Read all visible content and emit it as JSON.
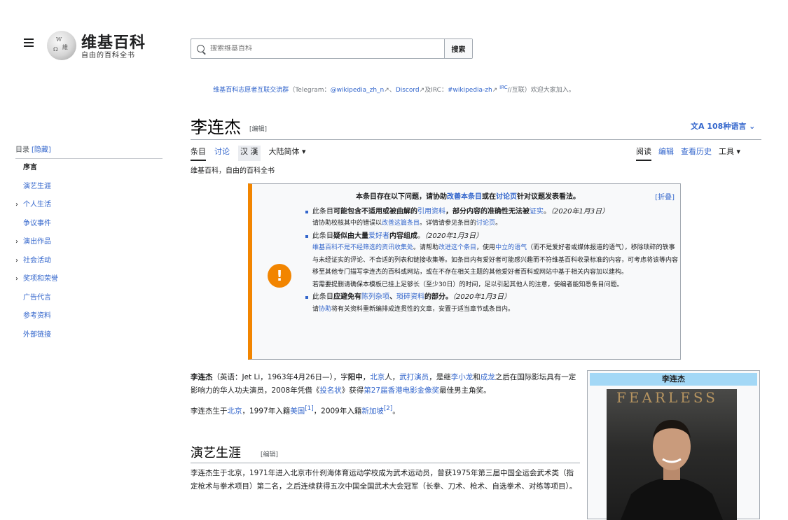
{
  "header": {
    "wordmark": "维基百科",
    "tagline": "自由的百科全书",
    "search_placeholder": "搜索维基百科",
    "search_button": "搜索",
    "globe_glyphs": [
      "W",
      "維",
      "Ω"
    ]
  },
  "sitenotice": {
    "part1": "维基百科志愿者互联交流群",
    "part2": "（Telegram：",
    "telegram": "@wikipedia_zh_n",
    "discord": "Discord",
    "part3": "及IRC：",
    "irc": "#wikipedia-zh",
    "irc_sup": "IRC",
    "part4": "//互联）欢迎大家加入。"
  },
  "title": {
    "text": "李连杰",
    "edit": "[编辑]",
    "languages": "108种语言"
  },
  "tabs": {
    "article": "条目",
    "talk": "讨论",
    "variant": "汉 漢",
    "variant_select": "大陆简体 ▾",
    "read": "阅读",
    "edit": "编辑",
    "history": "查看历史",
    "tools": "工具 ▾"
  },
  "from_wiki": "维基百科，自由的百科全书",
  "toc": {
    "heading": "目录",
    "hide": "[隐藏]",
    "items": [
      {
        "label": "序言",
        "chev": ""
      },
      {
        "label": "演艺生涯",
        "chev": ""
      },
      {
        "label": "个人生活",
        "chev": "›"
      },
      {
        "label": "争议事件",
        "chev": ""
      },
      {
        "label": "演出作品",
        "chev": "›"
      },
      {
        "label": "社会活动",
        "chev": "›"
      },
      {
        "label": "奖项和荣誉",
        "chev": "›"
      },
      {
        "label": "广告代言",
        "chev": ""
      },
      {
        "label": "参考资料",
        "chev": ""
      },
      {
        "label": "外部链接",
        "chev": ""
      }
    ]
  },
  "ambox": {
    "title_a": "本条目存在以下问题",
    "title_b": "，请协助",
    "title_link1": "改善本条目",
    "title_c": "或在",
    "title_link2": "讨论页",
    "title_d": "针对议题发表看法。",
    "toggle": "[折叠]",
    "i1_a": "此条目",
    "i1_b": "可能包含不适用或被曲解的",
    "i1_link": "引用资料",
    "i1_c": "，部分内容的准确性无法被",
    "i1_link2": "证实",
    "i1_d": "。",
    "i1_date": "（2020年1月3日）",
    "i1_sub_a": "请协助校核其中的错误以",
    "i1_sub_link": "改善这篇条目",
    "i1_sub_b": "。详情请参见条目的",
    "i1_sub_link2": "讨论页",
    "i1_sub_c": "。",
    "i2_a": "此条目",
    "i2_b": "疑似由大量",
    "i2_link": "爱好者",
    "i2_c": "内容组成",
    "i2_d": "。",
    "i2_date": "（2020年1月3日）",
    "i2_sub_link": "维基百科不是不经筛选的资讯收集处",
    "i2_sub_a": "。请帮助",
    "i2_sub_link2": "改进这个条目",
    "i2_sub_b": "，使用",
    "i2_sub_link3": "中立的语气",
    "i2_sub_c": "（而不是爱好者或媒体报道的语气），移除琐碎的轶事与未经证实的评论、不合适的列表和链接收集等。如条目内有爱好者可能感兴趣而不符维基百科收录标准的内容，可考虑将该等内容移至其他专门描写李连杰的百科或网站，或在不存在相关主题的其他爱好者百科或网站中基于相关内容加以建构。",
    "i2_sub_d": "若需要提删请确保本模板已挂上足够长（至少30日）的时间，足以引起其他人的注意，使编者能知悉条目问题。",
    "i3_a": "此条目",
    "i3_b": "应避免有",
    "i3_link": "陈列杂项",
    "i3_c": "、",
    "i3_link2": "琐碎资料",
    "i3_d": "的部分。",
    "i3_date": "（2020年1月3日）",
    "i3_sub_a": "请",
    "i3_sub_link": "协助",
    "i3_sub_b": "将有关资料重新编排成连贯性的文章，安置于适当章节或条目内。",
    "icon_glyph": "!"
  },
  "infobox": {
    "title": "李连杰",
    "photo_text": "FEARLESS"
  },
  "body": {
    "p1_name": "李连杰",
    "p1_a": "（英语：Jet Li，1963年4月26日—），字",
    "p1_zi": "阳中",
    "p1_b": "，",
    "p1_link1": "北京",
    "p1_c": "人，",
    "p1_link2": "武打演员",
    "p1_d": "，是继",
    "p1_link3": "李小龙",
    "p1_e": "和",
    "p1_link4": "成龙",
    "p1_f": "之后在国际影坛具有一定影响力的华人功夫演员，2008年凭借《",
    "p1_link5": "投名状",
    "p1_g": "》获得",
    "p1_link6": "第27届香港电影金像奖",
    "p1_h": "最佳男主角奖。",
    "p2_a": "李连杰生于",
    "p2_link1": "北京",
    "p2_b": "，1997年入籍",
    "p2_link2": "美国",
    "p2_ref1": "[1]",
    "p2_c": "，2009年入籍",
    "p2_link3": "新加坡",
    "p2_ref2": "[2]",
    "p2_d": "。",
    "section_heading": "演艺生涯",
    "section_edit": "[编辑]",
    "p3": "李连杰生于北京，1971年进入北京市什刹海体育运动学校成为武术运动员，曾获1975年第三届中国全运会武术类（指定枪术与拳术项目）第二名，之后连续获得五次中国全国武术大会冠军（长拳、刀术、枪术、自选拳术、对练等项目）。"
  }
}
